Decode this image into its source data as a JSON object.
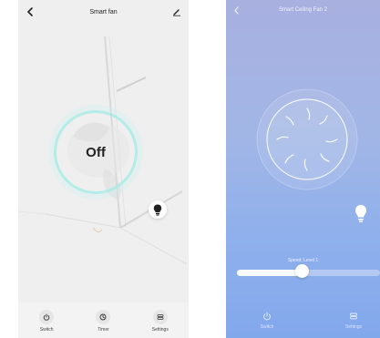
{
  "left_screen": {
    "title": "Smart fan",
    "status": "Off",
    "tabs": [
      {
        "label": "Switch",
        "icon": "power-icon"
      },
      {
        "label": "Timer",
        "icon": "clock-icon"
      },
      {
        "label": "Settings",
        "icon": "settings-icon"
      }
    ],
    "colors": {
      "background": "#efefef",
      "ring": "#a0ebe6"
    }
  },
  "right_screen": {
    "title": "Smart Ceiling Fan 2",
    "speed_label": "Speed: Level 1",
    "speed_fraction": 0.45,
    "tabs": [
      {
        "label": "Switch",
        "icon": "power-icon"
      },
      {
        "label": "Settings",
        "icon": "settings-icon"
      }
    ],
    "colors": {
      "gradient_top": "#a8b0e0",
      "gradient_bottom": "#82a8ec"
    }
  }
}
